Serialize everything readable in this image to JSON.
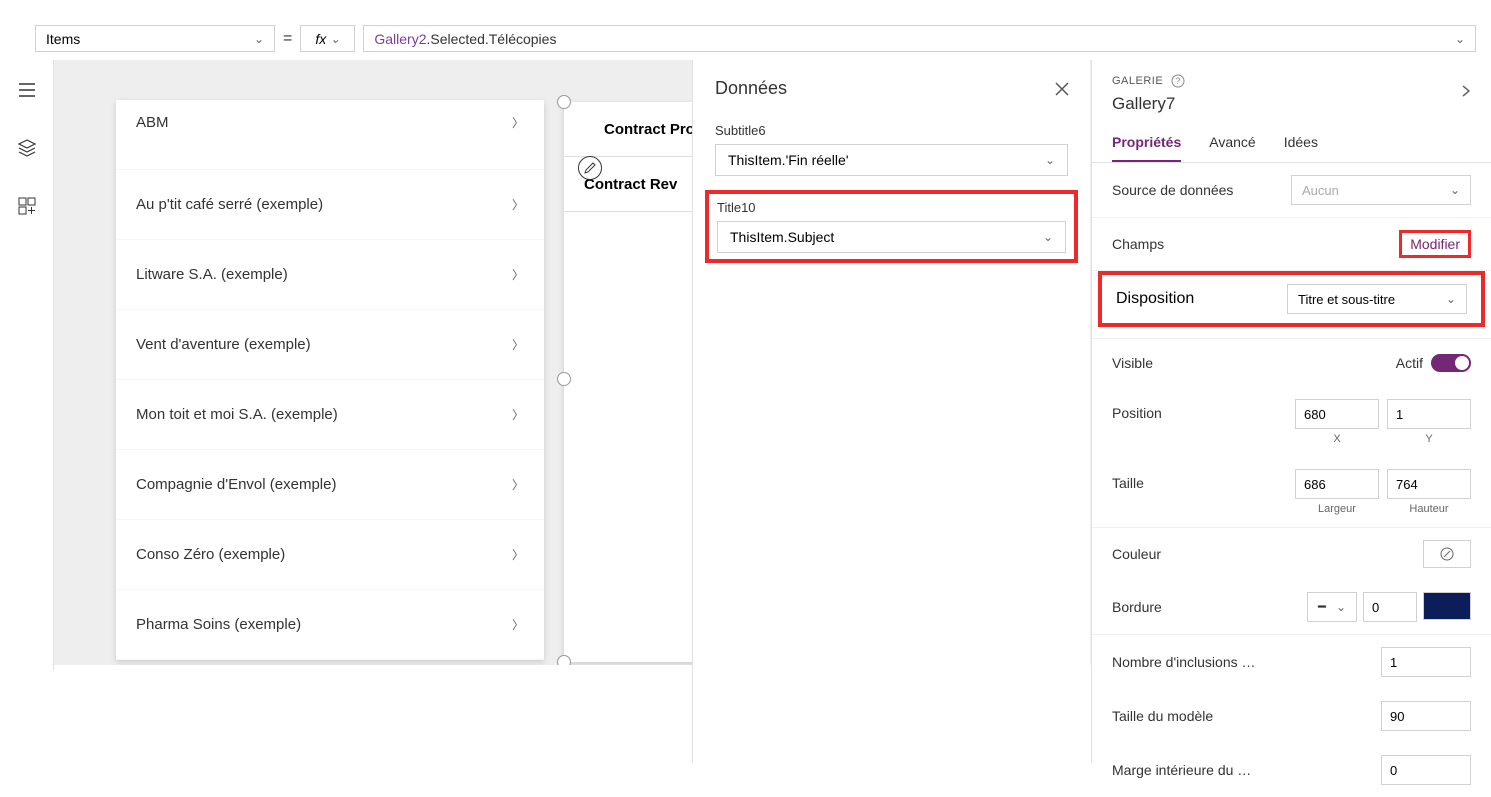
{
  "formulaBar": {
    "property": "Items",
    "fx": "fx",
    "formula_obj": "Gallery2",
    "formula_rest": ".Selected.Télécopies"
  },
  "gallery1": {
    "items": [
      "ABM",
      "Au p'tit café serré (exemple)",
      "Litware S.A. (exemple)",
      "Vent d'aventure (exemple)",
      "Mon toit et moi S.A. (exemple)",
      "Compagnie d'Envol (exemple)",
      "Conso Zéro (exemple)",
      "Pharma Soins (exemple)"
    ]
  },
  "gallery2": {
    "items": [
      "Contract Pro",
      "Contract Rev"
    ]
  },
  "dataPanel": {
    "title": "Données",
    "subtitle_label": "Subtitle6",
    "subtitle_value": "ThisItem.'Fin réelle'",
    "title_label": "Title10",
    "title_value": "ThisItem.Subject"
  },
  "props": {
    "sectionLabel": "GALERIE",
    "name": "Gallery7",
    "tabs": {
      "properties": "Propriétés",
      "advanced": "Avancé",
      "ideas": "Idées"
    },
    "dataSource": {
      "label": "Source de données",
      "value": "Aucun"
    },
    "fields": {
      "label": "Champs",
      "action": "Modifier"
    },
    "layout": {
      "label": "Disposition",
      "value": "Titre et sous-titre"
    },
    "visible": {
      "label": "Visible",
      "state": "Actif"
    },
    "position": {
      "label": "Position",
      "x": "680",
      "y": "1",
      "xl": "X",
      "yl": "Y"
    },
    "size": {
      "label": "Taille",
      "w": "686",
      "h": "764",
      "wl": "Largeur",
      "hl": "Hauteur"
    },
    "color": {
      "label": "Couleur"
    },
    "border": {
      "label": "Bordure",
      "value": "0"
    },
    "inclusions": {
      "label": "Nombre d'inclusions …",
      "value": "1"
    },
    "templateSize": {
      "label": "Taille du modèle",
      "value": "90"
    },
    "padding": {
      "label": "Marge intérieure du …",
      "value": "0"
    }
  }
}
